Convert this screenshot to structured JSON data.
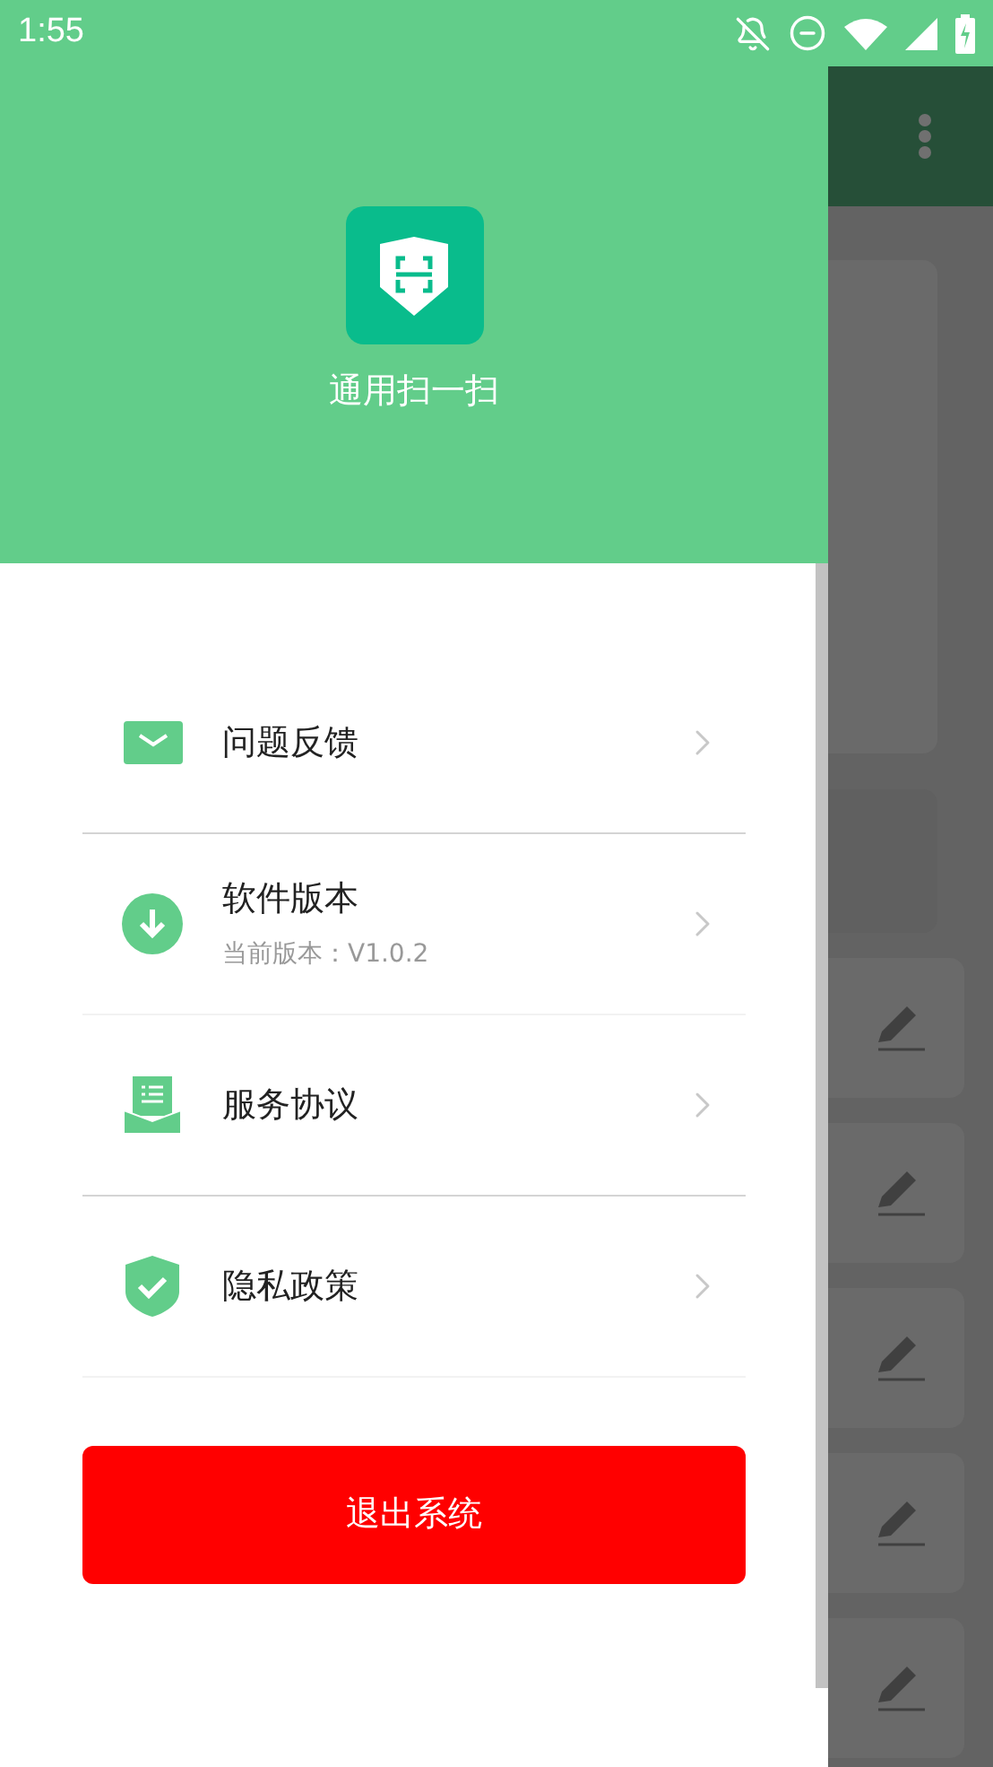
{
  "status_bar": {
    "time": "1:55"
  },
  "drawer": {
    "app_name": "通用扫一扫",
    "items": [
      {
        "kind": "mail",
        "label": "问题反馈"
      },
      {
        "kind": "download",
        "label": "软件版本",
        "subtitle": "当前版本：V1.0.2"
      },
      {
        "kind": "document",
        "label": "服务协议"
      },
      {
        "kind": "shield",
        "label": "隐私政策"
      }
    ],
    "logout_button": "退出系统"
  }
}
